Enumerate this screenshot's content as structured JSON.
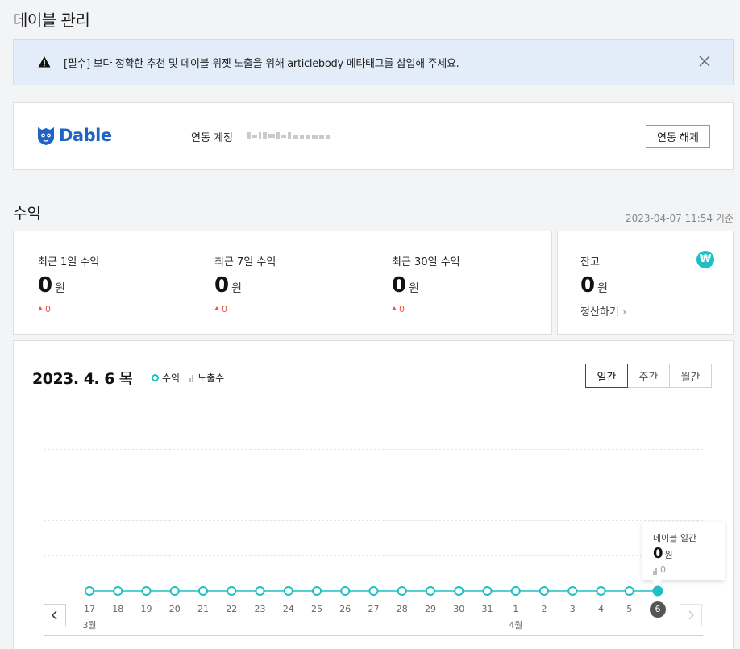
{
  "page": {
    "title": "데이블 관리"
  },
  "alert": {
    "text": "[필수] 보다 정확한 추천 및 데이블 위젯 노출을 위해 articlebody 메타태그를 삽입해 주세요."
  },
  "link": {
    "logo_text": "Dable",
    "account_label": "연동 계정",
    "unlink_label": "연동 해제"
  },
  "revenue": {
    "section_title": "수익",
    "as_of": "2023-04-07 11:54 기준",
    "stats": [
      {
        "label": "최근 1일 수익",
        "value": "0",
        "unit": "원",
        "delta": "0"
      },
      {
        "label": "최근 7일 수익",
        "value": "0",
        "unit": "원",
        "delta": "0"
      },
      {
        "label": "최근 30일 수익",
        "value": "0",
        "unit": "원",
        "delta": "0"
      }
    ],
    "balance": {
      "label": "잔고",
      "value": "0",
      "unit": "원",
      "action": "정산하기",
      "icon": "won-icon"
    }
  },
  "chart": {
    "date_main": "2023. 4. 6",
    "date_weekday": "목",
    "legend": {
      "revenue": "수익",
      "impressions": "노출수"
    },
    "tabs": [
      {
        "label": "일간",
        "active": true
      },
      {
        "label": "주간",
        "active": false
      },
      {
        "label": "월간",
        "active": false
      }
    ],
    "tooltip": {
      "title": "데이블 일간",
      "value": "0",
      "unit": "원",
      "impressions": "0"
    },
    "colors": {
      "line": "#1fbfc3",
      "selected": "#555555"
    }
  },
  "chart_data": {
    "type": "line",
    "categories": [
      "17",
      "18",
      "19",
      "20",
      "21",
      "22",
      "23",
      "24",
      "25",
      "26",
      "27",
      "28",
      "29",
      "30",
      "31",
      "1",
      "2",
      "3",
      "4",
      "5",
      "6"
    ],
    "month_labels": [
      {
        "index": 0,
        "label": "3월"
      },
      {
        "index": 15,
        "label": "4월"
      }
    ],
    "selected_index": 20,
    "series": [
      {
        "name": "수익",
        "values": [
          0,
          0,
          0,
          0,
          0,
          0,
          0,
          0,
          0,
          0,
          0,
          0,
          0,
          0,
          0,
          0,
          0,
          0,
          0,
          0,
          0
        ]
      },
      {
        "name": "노출수",
        "values": [
          0,
          0,
          0,
          0,
          0,
          0,
          0,
          0,
          0,
          0,
          0,
          0,
          0,
          0,
          0,
          0,
          0,
          0,
          0,
          0,
          0
        ]
      }
    ],
    "ylim": [
      0,
      5
    ]
  }
}
